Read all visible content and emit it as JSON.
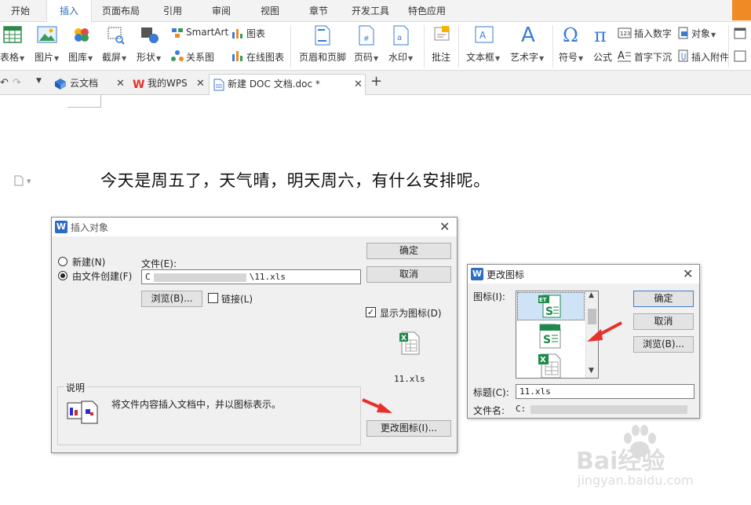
{
  "ribbon_tabs": [
    "开始",
    "插入",
    "页面布局",
    "引用",
    "审阅",
    "视图",
    "章节",
    "开发工具",
    "特色应用"
  ],
  "ribbon": {
    "table": "表格",
    "picture": "图片",
    "gallery": "图库",
    "screenshot": "截屏",
    "shape": "形状",
    "smartart": "SmartArt",
    "chart": "图表",
    "relation_map": "关系图",
    "online_chart": "在线图表",
    "header_footer": "页眉和页脚",
    "page_number": "页码",
    "watermark": "水印",
    "comment": "批注",
    "textbox": "文本框",
    "wordart": "艺术字",
    "symbol": "符号",
    "formula": "公式",
    "insert_number": "插入数字",
    "object": "对象",
    "drop_cap": "首字下沉",
    "insert_attachment": "插入附件"
  },
  "doc_tabs": {
    "cloud_doc": "云文档",
    "my_wps": "我的WPS",
    "current_doc": "新建 DOC 文档.doc *"
  },
  "document": {
    "line1": "今天是周五了，天气晴，明天周六，有什么安排呢。"
  },
  "insert_object_dialog": {
    "title": "插入对象",
    "new_label": "新建(N)",
    "from_file_label": "由文件创建(F)",
    "file_label": "文件(E):",
    "file_path_prefix": "C",
    "file_path_suffix": "\\11.xls",
    "browse_label": "浏览(B)...",
    "link_label": "链接(L)",
    "ok_label": "确定",
    "cancel_label": "取消",
    "show_as_icon_label": "显示为图标(D)",
    "icon_caption": "11.xls",
    "description_group": "说明",
    "description_text": "将文件内容插入文档中，并以图标表示。",
    "change_icon_label": "更改图标(I)..."
  },
  "change_icon_dialog": {
    "title": "更改图标",
    "icon_label": "图标(I):",
    "ok_label": "确定",
    "cancel_label": "取消",
    "browse_label": "浏览(B)...",
    "caption_label": "标题(C):",
    "caption_value": "11.xls",
    "filename_label": "文件名:",
    "filename_prefix": "C:"
  },
  "watermark": {
    "brand": "Bai经验",
    "url": "jingyan.baidu.com"
  },
  "colors": {
    "accent": "#2b6cc4",
    "excel_green": "#1e8a4a",
    "arrow_red": "#e8302a",
    "orange": "#f08a24"
  }
}
